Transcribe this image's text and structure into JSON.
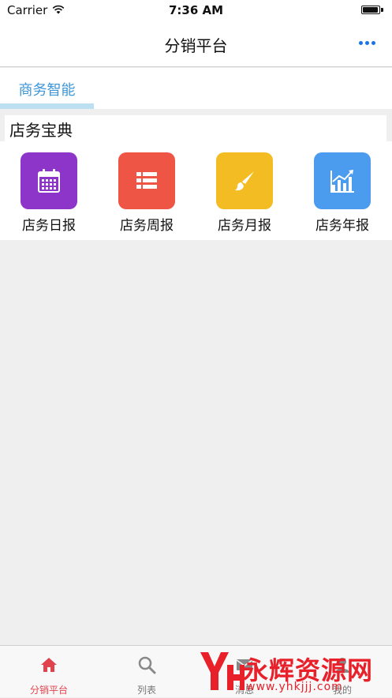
{
  "status_bar": {
    "carrier": "Carrier",
    "time": "7:36 AM"
  },
  "nav": {
    "title": "分销平台",
    "more_icon": "more-horizontal-icon",
    "accent_color": "#1a73e8"
  },
  "segment": {
    "tabs": [
      {
        "label": "商务智能",
        "selected": true
      }
    ],
    "selected_color": "#3d96d8"
  },
  "section": {
    "title": "店务宝典",
    "items": [
      {
        "label": "店务日报",
        "icon": "calendar-icon",
        "color": "#8e35c9"
      },
      {
        "label": "店务周报",
        "icon": "list-icon",
        "color": "#ef5545"
      },
      {
        "label": "店务月报",
        "icon": "brush-icon",
        "color": "#f2bc22"
      },
      {
        "label": "店务年报",
        "icon": "chart-icon",
        "color": "#4b9cee"
      }
    ]
  },
  "tab_bar": {
    "items": [
      {
        "label": "分销平台",
        "icon": "home-icon",
        "active": true
      },
      {
        "label": "列表",
        "icon": "search-icon",
        "active": false
      },
      {
        "label": "消息",
        "icon": "mail-icon",
        "active": false
      },
      {
        "label": "我的",
        "icon": "user-icon",
        "active": false
      }
    ],
    "active_color": "#e0434e"
  },
  "watermark": {
    "text": "永辉资源网",
    "url": "www.yhkjjj.com"
  }
}
